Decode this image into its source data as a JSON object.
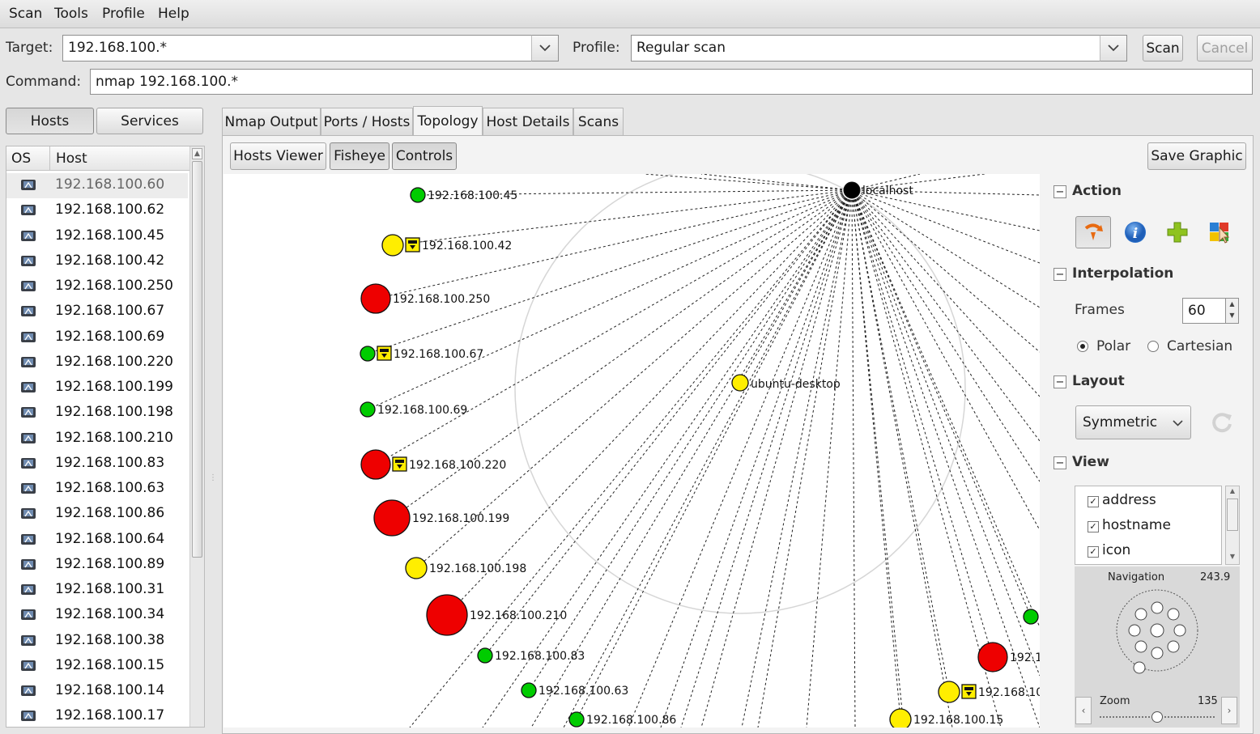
{
  "menu": [
    "Scan",
    "Tools",
    "Profile",
    "Help"
  ],
  "target": {
    "label": "Target:",
    "value": "192.168.100.*"
  },
  "profile": {
    "label": "Profile:",
    "value": "Regular scan"
  },
  "buttons": {
    "scan": "Scan",
    "cancel": "Cancel"
  },
  "command": {
    "label": "Command:",
    "value": "nmap 192.168.100.*"
  },
  "left_tabs": {
    "hosts": "Hosts",
    "services": "Services"
  },
  "host_list": {
    "columns": {
      "os": "OS",
      "host": "Host"
    },
    "selected": "192.168.100.60",
    "rows": [
      "192.168.100.60",
      "192.168.100.62",
      "192.168.100.45",
      "192.168.100.42",
      "192.168.100.250",
      "192.168.100.67",
      "192.168.100.69",
      "192.168.100.220",
      "192.168.100.199",
      "192.168.100.198",
      "192.168.100.210",
      "192.168.100.83",
      "192.168.100.63",
      "192.168.100.86",
      "192.168.100.64",
      "192.168.100.89",
      "192.168.100.31",
      "192.168.100.34",
      "192.168.100.38",
      "192.168.100.15",
      "192.168.100.14",
      "192.168.100.17"
    ]
  },
  "tabs": [
    "Nmap Output",
    "Ports / Hosts",
    "Topology",
    "Host Details",
    "Scans"
  ],
  "active_tab": "Topology",
  "toolbar": {
    "hosts_viewer": "Hosts Viewer",
    "fisheye": "Fisheye",
    "controls": "Controls",
    "save_graphic": "Save Graphic"
  },
  "topology": {
    "center_label": "localhost",
    "ring_node_label": "ubuntu-desktop",
    "nodes": [
      {
        "label": "192.168.100.45",
        "color": "#00cc00",
        "size": "small",
        "locked": false
      },
      {
        "label": "192.168.100.42",
        "color": "#ffee00",
        "size": "medium",
        "locked": true
      },
      {
        "label": "192.168.100.250",
        "color": "#ee0000",
        "size": "large",
        "locked": false
      },
      {
        "label": "192.168.100.67",
        "color": "#00cc00",
        "size": "small",
        "locked": true
      },
      {
        "label": "192.168.100.69",
        "color": "#00cc00",
        "size": "small",
        "locked": false
      },
      {
        "label": "192.168.100.220",
        "color": "#ee0000",
        "size": "large",
        "locked": true
      },
      {
        "label": "192.168.100.199",
        "color": "#ee0000",
        "size": "xlarge",
        "locked": false
      },
      {
        "label": "192.168.100.198",
        "color": "#ffee00",
        "size": "medium",
        "locked": false
      },
      {
        "label": "192.168.100.210",
        "color": "#ee0000",
        "size": "xxlarge",
        "locked": false
      },
      {
        "label": "192.168.100.83",
        "color": "#00cc00",
        "size": "small",
        "locked": false
      },
      {
        "label": "192.168.100.63",
        "color": "#00cc00",
        "size": "small",
        "locked": false
      },
      {
        "label": "192.168.100.86",
        "color": "#00cc00",
        "size": "small",
        "locked": false
      },
      {
        "label": "192.168.100.15",
        "color": "#ffee00",
        "size": "medium",
        "locked": false
      },
      {
        "label": "192.168.10",
        "color": "#ffee00",
        "size": "medium",
        "locked": true
      },
      {
        "label": "192.1",
        "color": "#ee0000",
        "size": "large",
        "locked": false
      },
      {
        "label": "",
        "color": "#00cc00",
        "size": "small",
        "locked": false
      }
    ]
  },
  "controls": {
    "action": {
      "title": "Action",
      "icons": [
        "change-focus-icon",
        "info-icon",
        "group-icon",
        "region-icon"
      ]
    },
    "interpolation": {
      "title": "Interpolation",
      "frames_label": "Frames",
      "frames_value": "60",
      "polar": "Polar",
      "cartesian": "Cartesian",
      "selected": "Polar"
    },
    "layout": {
      "title": "Layout",
      "value": "Symmetric"
    },
    "view": {
      "title": "View",
      "items": [
        {
          "label": "address",
          "checked": true
        },
        {
          "label": "hostname",
          "checked": true
        },
        {
          "label": "icon",
          "checked": true
        }
      ]
    },
    "navigation": {
      "label": "Navigation",
      "value": "243.9"
    },
    "zoom": {
      "label": "Zoom",
      "value": "135"
    }
  }
}
